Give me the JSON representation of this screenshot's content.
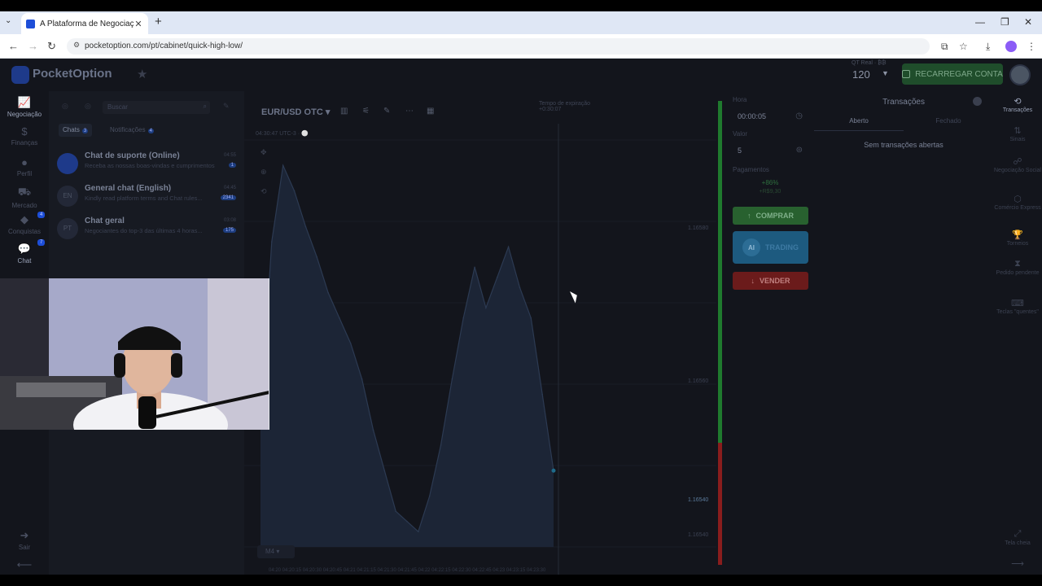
{
  "browser": {
    "tab_title": "A Plataforma de Negociação M",
    "url": "pocketoption.com/pt/cabinet/quick-high-low/"
  },
  "header": {
    "logo": "PocketOption",
    "account_label": "QT Real · ₿₿",
    "account_value": "120",
    "recharge_label": "RECARREGAR CONTA"
  },
  "left_nav": [
    {
      "label": "Negociação",
      "icon": "chart-line-icon"
    },
    {
      "label": "Finanças",
      "icon": "dollar-icon"
    },
    {
      "label": "Perfil",
      "icon": "user-icon"
    },
    {
      "label": "Mercado",
      "icon": "cart-icon"
    },
    {
      "label": "Conquistas",
      "icon": "diamond-icon",
      "badge": "4"
    },
    {
      "label": "Chat",
      "icon": "chat-icon",
      "badge": "7"
    }
  ],
  "left_nav_bottom": {
    "exit": "Sair"
  },
  "chat": {
    "search_placeholder": "Buscar",
    "tabs": [
      {
        "label": "Chats",
        "count": "3"
      },
      {
        "label": "Notificações",
        "count": "4"
      }
    ],
    "items": [
      {
        "initials": "",
        "name": "Chat de suporte (Online)",
        "preview": "Receba as nossas boas-vindas e cumprimentos",
        "time": "04:55",
        "count": "1"
      },
      {
        "initials": "EN",
        "name": "General chat (English)",
        "preview": "Kindly read platform terms and Chat rules...",
        "time": "04:45",
        "count": "2341"
      },
      {
        "initials": "PT",
        "name": "Chat geral",
        "preview": "Negociantes do top-3 das últimas 4 horas...",
        "time": "03:08",
        "count": "175"
      }
    ]
  },
  "chart": {
    "pair": "EUR/USD OTC",
    "subheader": "04:30:47 UTC-3 · ⚪",
    "expiry_label": "Tempo de expiração",
    "expiry_value": "+0:30:07",
    "timeframe": "M4",
    "price_labels": [
      "1.16580",
      "1.16560",
      "1.16540",
      "1.16540"
    ],
    "time_labels": "04:20 04:20:15 04:20:30 04:20:45 04:21 04:21:15 04:21:30 04:21:45 04:22 04:22:15 04:22:30 04:22:45 04:23 04:23:15 04:23:30"
  },
  "trade": {
    "time_label": "Hora",
    "time_value": "00:00:05",
    "amount_label": "Valor",
    "amount_value": "5",
    "payout_label": "Pagamentos",
    "payout_pct": "+86%",
    "payout_amount": "+R$9,30",
    "buy_label": "COMPRAR",
    "ai_label": "TRADING",
    "ai_badge": "AI",
    "sell_label": "VENDER"
  },
  "transactions": {
    "title": "Transações",
    "tab_open": "Aberto",
    "tab_closed": "Fechado",
    "empty": "Sem transações abertas"
  },
  "right_nav": [
    {
      "label": "Transações",
      "icon": "history-icon"
    },
    {
      "label": "Sinais",
      "icon": "signal-icon"
    },
    {
      "label": "Negociação Social",
      "icon": "social-icon"
    },
    {
      "label": "Comércio Express",
      "icon": "express-icon"
    },
    {
      "label": "Torneios",
      "icon": "trophy-icon"
    },
    {
      "label": "Pedido pendente",
      "icon": "hourglass-icon"
    },
    {
      "label": "Teclas \"quentes\"",
      "icon": "keyboard-icon"
    },
    {
      "label": "Tela cheia",
      "icon": "fullscreen-icon"
    }
  ],
  "chart_data": {
    "type": "area",
    "series": [
      {
        "values": [
          1.1654,
          1.16575,
          1.1659,
          1.16585,
          1.16578,
          1.16572,
          1.16565,
          1.1656,
          1.16555,
          1.16548,
          1.16538,
          1.1653,
          1.16522,
          1.1652,
          1.16518,
          1.16525,
          1.16535,
          1.16548,
          1.1656,
          1.1657,
          1.16562,
          1.16568,
          1.16574,
          1.16566,
          1.1656,
          1.16545,
          1.1653
        ]
      }
    ],
    "ylim": [
      1.16515,
      1.16595
    ]
  }
}
